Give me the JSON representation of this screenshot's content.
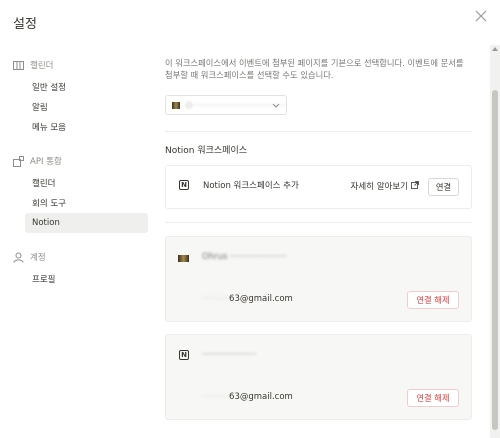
{
  "dialog": {
    "title": "설정"
  },
  "sidebar": {
    "groups": [
      {
        "label": "캘린더",
        "icon": "calendar-icon",
        "items": [
          {
            "label": "일반 설정"
          },
          {
            "label": "알림"
          },
          {
            "label": "메뉴 모음"
          }
        ]
      },
      {
        "label": "API 통합",
        "icon": "api-integration-icon",
        "items": [
          {
            "label": "캘린더"
          },
          {
            "label": "회의 도구"
          },
          {
            "label": "Notion",
            "active": true
          }
        ]
      },
      {
        "label": "계정",
        "icon": "person-icon",
        "items": [
          {
            "label": "프로필"
          }
        ]
      }
    ]
  },
  "main": {
    "description": "이 워크스페이스에서 이벤트에 첨부된 페이지를 기본으로 선택합니다. 이벤트에 문서를 첨부할 때 워크스페이스를 선택할 수도 있습니다.",
    "workspace_select": {
      "value": "O·····································"
    },
    "section_title": "Notion 워크스페이스",
    "add_card": {
      "label": "Notion 워크스페이스 추가",
      "learn_more": "자세히 알아보기",
      "connect_button": "연결"
    },
    "accounts": [
      {
        "workspace_name": "Ohrus ·····················",
        "email_mask": "··········",
        "email_suffix": "63@gmail.com",
        "disconnect": "연결 해제"
      },
      {
        "workspace_name": "····················",
        "email_mask": "··········",
        "email_suffix": "63@gmail.com",
        "disconnect": "연결 해제"
      }
    ]
  },
  "colors": {
    "accent_red": "#e03e3e",
    "active_bg": "#efefed"
  }
}
